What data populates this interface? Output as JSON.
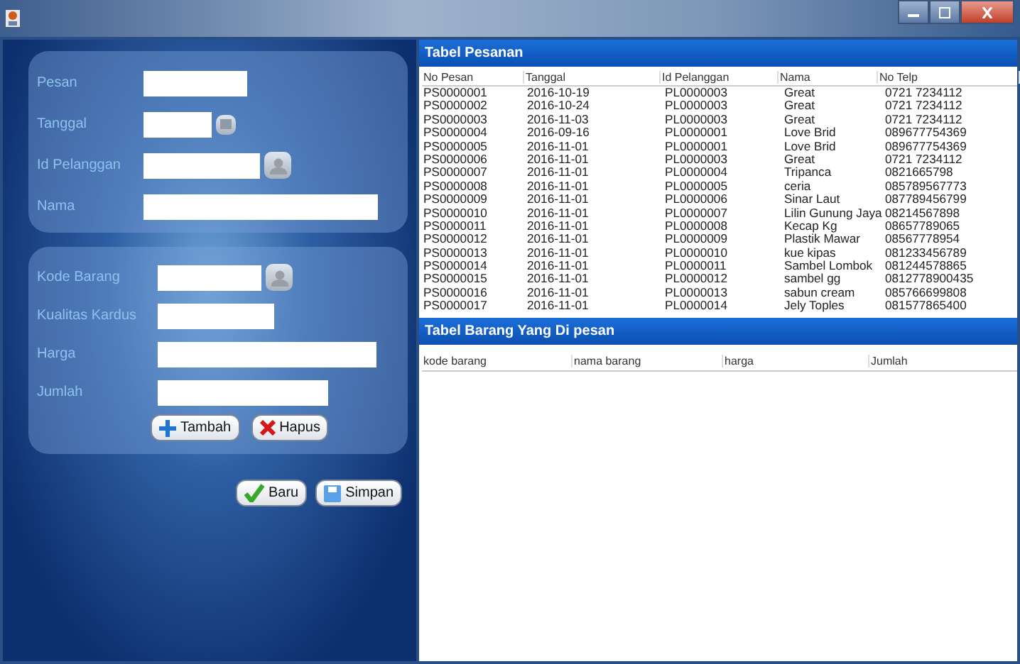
{
  "order_form": {
    "fields": [
      {
        "label": "Pesan",
        "kind": "text"
      },
      {
        "label": "Tanggal",
        "kind": "date"
      },
      {
        "label": "Id Pelanggan",
        "kind": "lookup"
      },
      {
        "label": "Nama",
        "kind": "text"
      }
    ]
  },
  "item_form": {
    "fields": [
      {
        "label": "Kode Barang",
        "kind": "lookup"
      },
      {
        "label": "Kualitas Kardus",
        "kind": "text"
      },
      {
        "label": "Harga",
        "kind": "text"
      },
      {
        "label": "Jumlah",
        "kind": "text"
      }
    ],
    "buttons": [
      {
        "label": "Tambah",
        "kind": "add"
      },
      {
        "label": "Hapus",
        "kind": "delete"
      }
    ]
  },
  "actions": [
    {
      "label": "Baru",
      "kind": "new"
    },
    {
      "label": "Simpan",
      "kind": "save"
    }
  ],
  "orders_table": {
    "title": "Tabel Pesanan",
    "columns": [
      "No Pesan",
      "Tanggal",
      "Id Pelanggan",
      "Nama",
      "No Telp"
    ],
    "rows": [
      [
        "PS0000001",
        "2016-10-19",
        "PL0000003",
        "Great",
        "0721 7234112"
      ],
      [
        "PS0000002",
        "2016-10-24",
        "PL0000003",
        "Great",
        "0721 7234112"
      ],
      [
        "PS0000003",
        "2016-11-03",
        "PL0000003",
        "Great",
        "0721 7234112"
      ],
      [
        "PS0000004",
        "2016-09-16",
        "PL0000001",
        "Love Brid",
        "089677754369"
      ],
      [
        "PS0000005",
        "2016-11-01",
        "PL0000001",
        "Love Brid",
        "089677754369"
      ],
      [
        "PS0000006",
        "2016-11-01",
        "PL0000003",
        "Great",
        "0721 7234112"
      ],
      [
        "PS0000007",
        "2016-11-01",
        "PL0000004",
        "Tripanca",
        "0821665798"
      ],
      [
        "PS0000008",
        "2016-11-01",
        "PL0000005",
        "ceria",
        "085789567773"
      ],
      [
        "PS0000009",
        "2016-11-01",
        "PL0000006",
        "Sinar Laut",
        "087789456799"
      ],
      [
        "PS0000010",
        "2016-11-01",
        "PL0000007",
        "Lilin Gunung Jaya",
        "08214567898"
      ],
      [
        "PS0000011",
        "2016-11-01",
        "PL0000008",
        "Kecap Kg",
        "08657789065"
      ],
      [
        "PS0000012",
        "2016-11-01",
        "PL0000009",
        "Plastik Mawar",
        "08567778954"
      ],
      [
        "PS0000013",
        "2016-11-01",
        "PL0000010",
        "kue kipas",
        "081233456789"
      ],
      [
        "PS0000014",
        "2016-11-01",
        "PL0000011",
        "Sambel Lombok",
        "081244578865"
      ],
      [
        "PS0000015",
        "2016-11-01",
        "PL0000012",
        "sambel gg",
        "0812778900435"
      ],
      [
        "PS0000016",
        "2016-11-01",
        "PL0000013",
        "sabun cream",
        "085766699808"
      ],
      [
        "PS0000017",
        "2016-11-01",
        "PL0000014",
        "Jely Toples",
        "081577865400"
      ]
    ]
  },
  "items_table": {
    "title": "Tabel Barang Yang Di pesan",
    "columns": [
      "kode barang",
      "nama barang",
      "harga",
      "Jumlah"
    ]
  }
}
